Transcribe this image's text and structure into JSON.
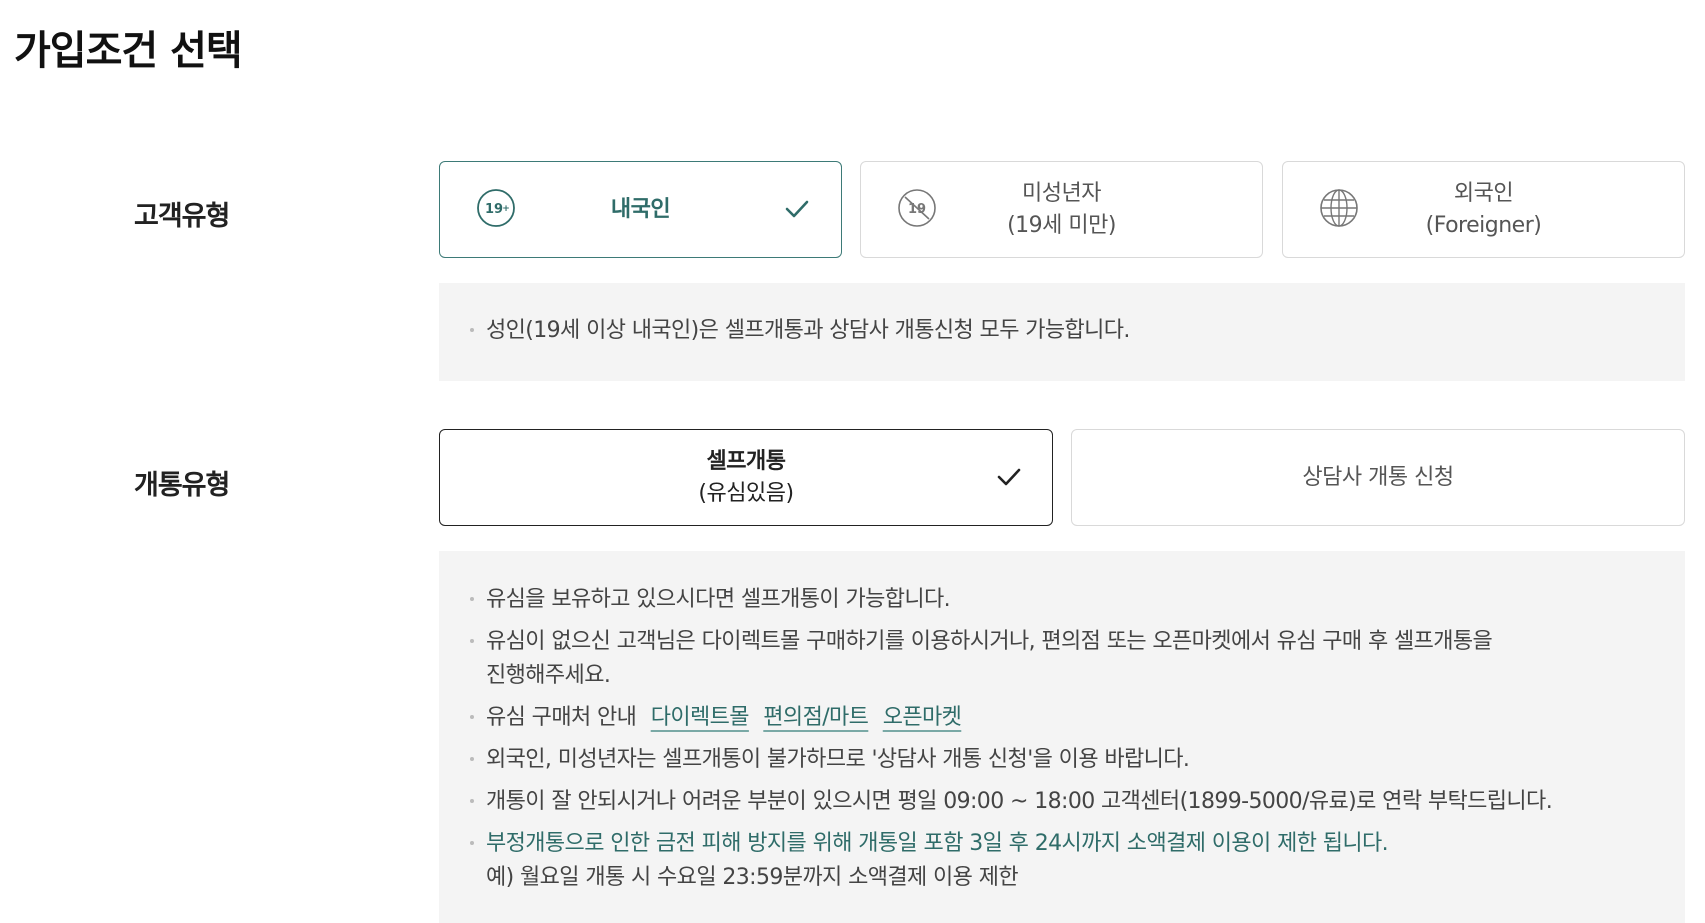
{
  "page": {
    "title": "가입조건 선택"
  },
  "customer_type": {
    "label": "고객유형",
    "options": [
      {
        "label": "내국인",
        "icon": "age-19-plus-icon",
        "selected": true
      },
      {
        "label_line1": "미성년자",
        "label_line2": "(19세 미만)",
        "icon": "no-19-icon",
        "selected": false
      },
      {
        "label_line1": "외국인",
        "label_line2": "(Foreigner)",
        "icon": "globe-icon",
        "selected": false
      }
    ],
    "notice": "성인(19세 이상 내국인)은 셀프개통과 상담사 개통신청 모두 가능합니다."
  },
  "activation_type": {
    "label": "개통유형",
    "options": [
      {
        "label_line1": "셀프개통",
        "label_line2": "(유심있음)",
        "selected": true
      },
      {
        "label": "상담사 개통 신청",
        "selected": false
      }
    ],
    "notices": {
      "n1": "유심을 보유하고 있으시다면 셀프개통이 가능합니다.",
      "n2_line1": "유심이 없으신 고객님은 다이렉트몰 구매하기를 이용하시거나, 편의점 또는 오픈마켓에서 유심 구매 후 셀프개통을",
      "n2_line2": "진행해주세요.",
      "n3_prefix": "유심 구매처 안내",
      "n3_links": [
        "다이렉트몰",
        "편의점/마트",
        "오픈마켓"
      ],
      "n4": "외국인, 미성년자는 셀프개통이 불가하므로 '상담사 개통 신청'을 이용 바랍니다.",
      "n5": "개통이 잘 안되시거나 어려운 부분이 있으시면 평일 09:00 ~ 18:00 고객센터(1899-5000/유료)로 연락 부탁드립니다.",
      "n6": "부정개통으로 인한 금전 피해 방지를 위해 개통일 포함 3일 후 24시까지 소액결제 이용이 제한 됩니다.",
      "n6_example": "예) 월요일 개통 시 수요일 23:59분까지 소액결제 이용 제한"
    }
  },
  "colors": {
    "accent_green": "#2f6c69",
    "selected_dark": "#222222",
    "notice_bg": "#f4f4f4"
  }
}
